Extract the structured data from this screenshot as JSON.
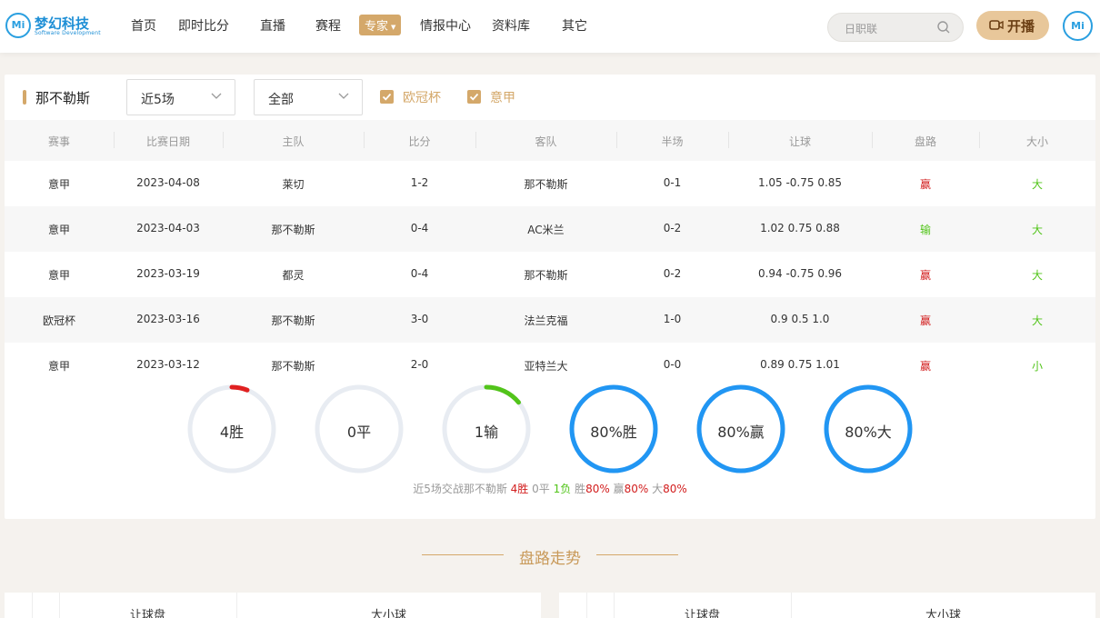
{
  "brand": {
    "name": "梦幻科技",
    "tagline": "Software Development",
    "badge": "Mi"
  },
  "nav": [
    {
      "label": "首页"
    },
    {
      "label": "即时比分"
    },
    {
      "label": "直播"
    },
    {
      "label": "赛程"
    },
    {
      "label": "专家",
      "active": true
    },
    {
      "label": "情报中心"
    },
    {
      "label": "资料库"
    },
    {
      "label": "其它"
    }
  ],
  "search": {
    "placeholder": "日职联"
  },
  "live_button": {
    "label": "开播"
  },
  "avatar": {
    "text": "Mi"
  },
  "filters": {
    "team": "那不勒斯",
    "range": "近5场",
    "scope": "全部",
    "checkboxes": [
      {
        "label": "欧冠杯",
        "checked": true
      },
      {
        "label": "意甲",
        "checked": true
      }
    ]
  },
  "table": {
    "columns": [
      "赛事",
      "比赛日期",
      "主队",
      "比分",
      "客队",
      "半场",
      "让球",
      "盘路",
      "大小"
    ],
    "rows": [
      {
        "league": "意甲",
        "date": "2023-04-08",
        "home": "莱切",
        "score": "1-2",
        "away": "那不勒斯",
        "half": "0-1",
        "handicap": "1.05 -0.75 0.85",
        "result": "赢",
        "ou": "大"
      },
      {
        "league": "意甲",
        "date": "2023-04-03",
        "home": "那不勒斯",
        "score": "0-4",
        "away": "AC米兰",
        "half": "0-2",
        "handicap": "1.02 0.75 0.88",
        "result": "输",
        "ou": "大"
      },
      {
        "league": "意甲",
        "date": "2023-03-19",
        "home": "都灵",
        "score": "0-4",
        "away": "那不勒斯",
        "half": "0-2",
        "handicap": "0.94 -0.75 0.96",
        "result": "赢",
        "ou": "大"
      },
      {
        "league": "欧冠杯",
        "date": "2023-03-16",
        "home": "那不勒斯",
        "score": "3-0",
        "away": "法兰克福",
        "half": "1-0",
        "handicap": "0.9 0.5 1.0",
        "result": "赢",
        "ou": "大"
      },
      {
        "league": "意甲",
        "date": "2023-03-12",
        "home": "那不勒斯",
        "score": "2-0",
        "away": "亚特兰大",
        "half": "0-0",
        "handicap": "0.89 0.75 1.01",
        "result": "赢",
        "ou": "小"
      }
    ]
  },
  "colors": {
    "win": "#d21d1d",
    "lose": "#52c41a",
    "ring_track": "#e8ecf2",
    "ring_blue": "#2196f3",
    "accent": "#d4a86a"
  },
  "stats": [
    {
      "label": "4胜",
      "fraction": 0.06,
      "color": "#e02020"
    },
    {
      "label": "0平",
      "fraction": 0,
      "color": "#2196f3"
    },
    {
      "label": "1输",
      "fraction": 0.14,
      "color": "#52c41a"
    },
    {
      "label": "80%胜",
      "fraction": 1,
      "color": "#2196f3"
    },
    {
      "label": "80%赢",
      "fraction": 1,
      "color": "#2196f3"
    },
    {
      "label": "80%大",
      "fraction": 1,
      "color": "#2196f3"
    }
  ],
  "summary": {
    "prefix": "近5场交战那不勒斯",
    "wins": "4胜",
    "draws": "0平",
    "losses": "1负",
    "win_word": "胜",
    "win_pct": "80%",
    "cover_word": "赢",
    "cover_pct": "80%",
    "over_word": "大",
    "over_pct": "80%"
  },
  "trend": {
    "title": "盘路走势",
    "left_headers": [
      "让球盘",
      "大小球"
    ],
    "right_headers": [
      "让球盘",
      "大小球"
    ]
  }
}
